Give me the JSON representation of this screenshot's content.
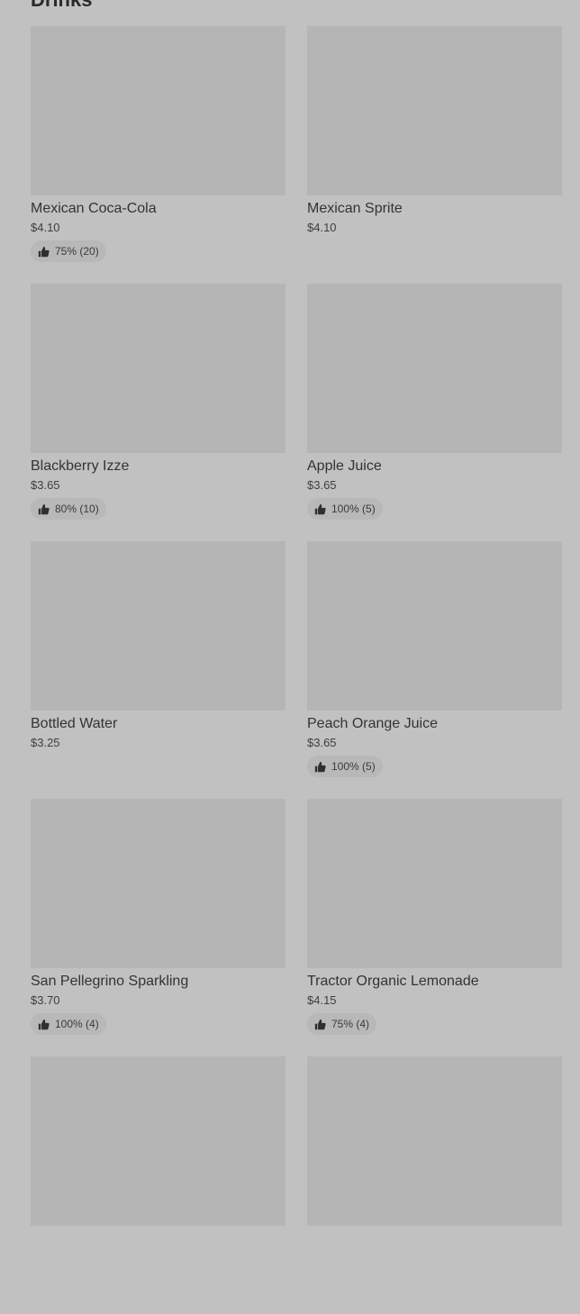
{
  "section": {
    "title": "Drinks"
  },
  "items": [
    {
      "name": "Mexican Coca-Cola",
      "price": "$4.10",
      "rating": "75% (20)"
    },
    {
      "name": "Mexican Sprite",
      "price": "$4.10",
      "rating": ""
    },
    {
      "name": "Blackberry Izze",
      "price": "$3.65",
      "rating": "80% (10)"
    },
    {
      "name": "Apple Juice",
      "price": "$3.65",
      "rating": "100% (5)"
    },
    {
      "name": "Bottled Water",
      "price": "$3.25",
      "rating": ""
    },
    {
      "name": "Peach Orange Juice",
      "price": "$3.65",
      "rating": "100% (5)"
    },
    {
      "name": "San Pellegrino Sparkling",
      "price": "$3.70",
      "rating": "100% (4)"
    },
    {
      "name": "Tractor Organic Lemonade",
      "price": "$4.15",
      "rating": "75% (4)"
    },
    {
      "name": "",
      "price": "",
      "rating": ""
    },
    {
      "name": "",
      "price": "",
      "rating": ""
    }
  ],
  "icons": {
    "rating": "thumbs-up-icon"
  },
  "colors": {
    "background": "#c1c1c1",
    "placeholder": "#b5b5b5",
    "badge": "#b8b8b8"
  }
}
